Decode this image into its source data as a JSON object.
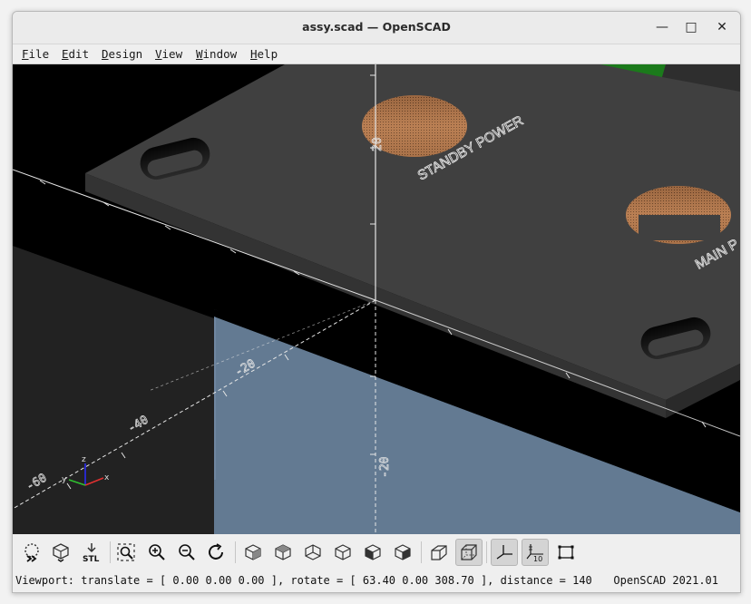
{
  "window": {
    "title": "assy.scad — OpenSCAD",
    "controls": {
      "minimize": "—",
      "maximize": "□",
      "close": "✕"
    }
  },
  "menubar": {
    "items": [
      {
        "first": "F",
        "rest": "ile"
      },
      {
        "first": "E",
        "rest": "dit"
      },
      {
        "first": "D",
        "rest": "esign"
      },
      {
        "first": "V",
        "rest": "iew"
      },
      {
        "first": "W",
        "rest": "indow"
      },
      {
        "first": "H",
        "rest": "elp"
      }
    ]
  },
  "viewport": {
    "panel_labels": [
      "STANDBY POWER",
      "MAIN P"
    ],
    "axis_ticks": [
      "20",
      "20",
      "-20",
      "-40",
      "-60",
      "-20"
    ],
    "gizmo": {
      "z": "z",
      "y": "y",
      "x": "x"
    },
    "colors": {
      "background": "#000000",
      "panel_top": "#3f3f3f",
      "panel_front": "#343434",
      "box": "#637a92",
      "hole": "#b87a4e",
      "gray_surface": "#232323",
      "green_part": "#1b7a1b"
    }
  },
  "toolbar": {
    "buttons": [
      {
        "name": "preview-button-icon"
      },
      {
        "name": "render-button-icon"
      },
      {
        "name": "export-stl-button-icon",
        "label": "STL"
      },
      {
        "name": "view-all-icon"
      },
      {
        "name": "zoom-in-icon"
      },
      {
        "name": "zoom-out-icon"
      },
      {
        "name": "reset-view-icon"
      },
      {
        "name": "view-right-icon"
      },
      {
        "name": "view-top-icon"
      },
      {
        "name": "view-bottom-icon"
      },
      {
        "name": "view-left-icon"
      },
      {
        "name": "view-front-icon"
      },
      {
        "name": "view-back-icon"
      },
      {
        "name": "perspective-icon"
      },
      {
        "name": "orthogonal-icon"
      },
      {
        "name": "show-axes-icon"
      },
      {
        "name": "show-scale-markers-icon",
        "label": "10"
      },
      {
        "name": "show-edges-icon"
      }
    ]
  },
  "status": {
    "viewport_text": "Viewport: translate = [ 0.00 0.00 0.00 ], rotate = [ 63.40 0.00 308.70 ], distance = 140",
    "version": "OpenSCAD 2021.01"
  }
}
